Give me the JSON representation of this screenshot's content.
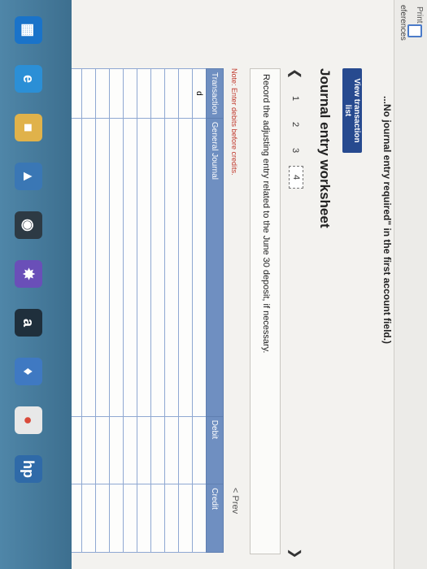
{
  "header": {
    "print_label": "Print",
    "references_label": "eferences",
    "instruction": "...No journal entry required\" in the first account field.)"
  },
  "toolbar": {
    "view_transaction_list": "View transaction list"
  },
  "worksheet": {
    "title": "Journal entry worksheet",
    "tabs": [
      "1",
      "2",
      "3",
      "4"
    ],
    "active_tab": "4",
    "prompt": "Record the adjusting entry related to the June 30 deposit, if necessary.",
    "note": "Note: Enter debits before credits."
  },
  "journal": {
    "columns": [
      "Transaction",
      "General Journal",
      "Debit",
      "Credit"
    ],
    "rows": [
      {
        "transaction": "d",
        "account": "",
        "debit": "",
        "credit": ""
      },
      {
        "transaction": "",
        "account": "",
        "debit": "",
        "credit": ""
      },
      {
        "transaction": "",
        "account": "",
        "debit": "",
        "credit": ""
      },
      {
        "transaction": "",
        "account": "",
        "debit": "",
        "credit": ""
      },
      {
        "transaction": "",
        "account": "",
        "debit": "",
        "credit": ""
      },
      {
        "transaction": "",
        "account": "",
        "debit": "",
        "credit": ""
      },
      {
        "transaction": "",
        "account": "",
        "debit": "",
        "credit": ""
      },
      {
        "transaction": "",
        "account": "",
        "debit": "",
        "credit": ""
      },
      {
        "transaction": "",
        "account": "",
        "debit": "",
        "credit": ""
      },
      {
        "transaction": "",
        "account": "",
        "debit": "",
        "credit": ""
      },
      {
        "transaction": "",
        "account": "",
        "debit": "",
        "credit": ""
      },
      {
        "transaction": "",
        "account": "",
        "debit": "",
        "credit": ""
      },
      {
        "transaction": "",
        "account": "",
        "debit": "",
        "credit": ""
      },
      {
        "transaction": "",
        "account": "",
        "debit": "",
        "credit": ""
      },
      {
        "transaction": "",
        "account": "",
        "debit": "",
        "credit": ""
      }
    ]
  },
  "pager": {
    "prev_label": "< Prev"
  },
  "taskbar": {
    "icons": [
      "internet-explorer-icon",
      "file-explorer-icon",
      "store-icon",
      "camera-icon",
      "photos-icon",
      "amazon-icon",
      "dropbox-icon",
      "chrome-icon",
      "hp-icon"
    ]
  }
}
